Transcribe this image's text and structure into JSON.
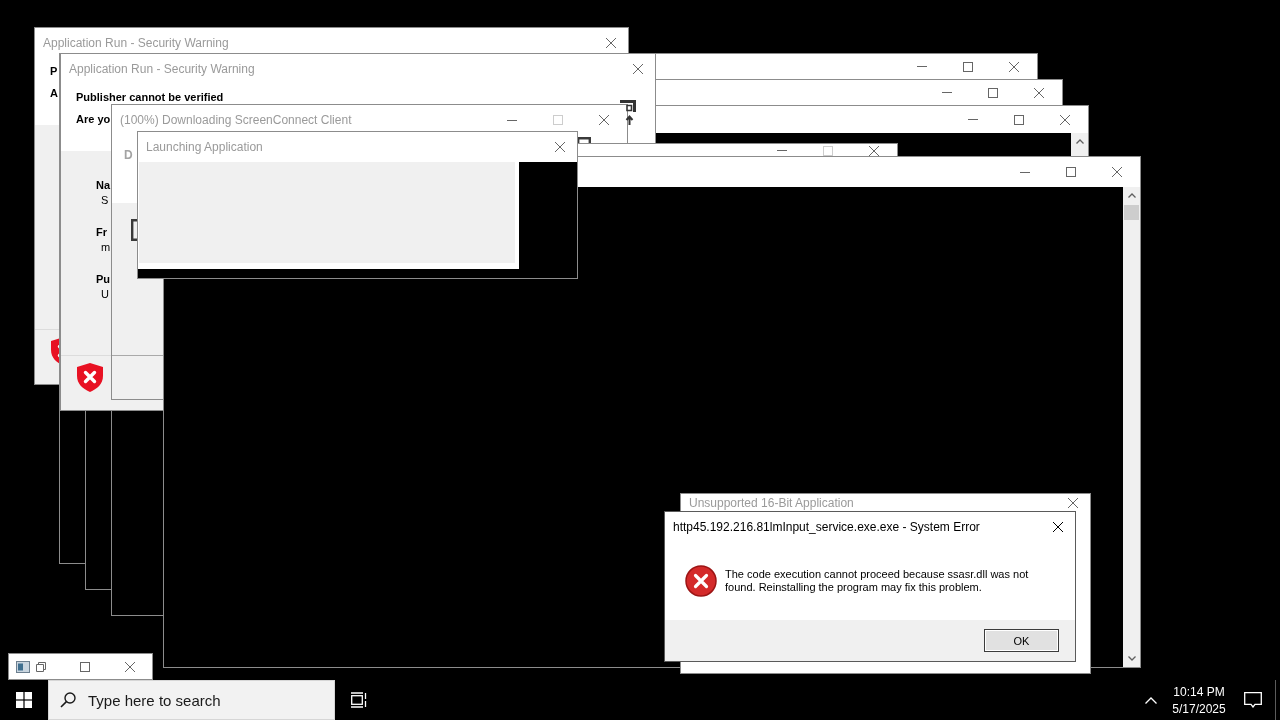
{
  "windows": [
    {
      "kind": "security_warning",
      "title": "Application Run - Security Warning",
      "active": false,
      "controls": [
        {
          "kind": "close",
          "disabled": false
        }
      ],
      "heading": [
        "P",
        "A"
      ]
    },
    {
      "kind": "security_warning",
      "title": "Application Run - Security Warning",
      "active": false,
      "controls": [
        {
          "kind": "close",
          "disabled": false
        }
      ],
      "heading": [
        "Publisher cannot be verified",
        "Are yo"
      ],
      "fields": [
        {
          "label": "Na",
          "value": "S"
        },
        {
          "label": "Fr",
          "value": "m"
        },
        {
          "label": "Pu",
          "value": "U"
        }
      ]
    },
    {
      "kind": "blank",
      "controls": [
        {
          "kind": "minimize",
          "disabled": false
        },
        {
          "kind": "maximize",
          "disabled": false
        },
        {
          "kind": "close",
          "disabled": false
        }
      ]
    },
    {
      "kind": "blank",
      "controls": [
        {
          "kind": "minimize",
          "disabled": false
        },
        {
          "kind": "maximize",
          "disabled": false
        },
        {
          "kind": "close",
          "disabled": false
        }
      ]
    },
    {
      "kind": "progress",
      "title": "(100%) Downloading ScreenConnect Client",
      "active": false,
      "controls": [
        {
          "kind": "minimize",
          "disabled": false
        },
        {
          "kind": "maximize",
          "disabled": true
        },
        {
          "kind": "close",
          "disabled": false
        }
      ],
      "status": "D"
    },
    {
      "kind": "blank",
      "controls": [
        {
          "kind": "minimize",
          "disabled": false
        },
        {
          "kind": "maximize",
          "disabled": false
        },
        {
          "kind": "close",
          "disabled": false
        }
      ]
    },
    {
      "kind": "launching",
      "title": "Launching Application",
      "active": false,
      "controls": [
        {
          "kind": "close",
          "disabled": false
        }
      ]
    },
    {
      "kind": "blank",
      "controls": [
        {
          "kind": "minimize",
          "disabled": false
        },
        {
          "kind": "maximize",
          "disabled": true
        },
        {
          "kind": "close",
          "disabled": false
        }
      ]
    },
    {
      "kind": "blank",
      "controls": [
        {
          "kind": "minimize",
          "disabled": false
        },
        {
          "kind": "maximize",
          "disabled": false
        },
        {
          "kind": "close",
          "disabled": false
        }
      ]
    },
    {
      "kind": "error",
      "title": "Unsupported 16-Bit Application",
      "active": false,
      "controls": [
        {
          "kind": "close",
          "disabled": false
        }
      ]
    },
    {
      "kind": "error",
      "title": "http45.192.216.81lmInput_service.exe.exe - System Error",
      "active": true,
      "controls": [
        {
          "kind": "close",
          "disabled": false
        }
      ],
      "message": "The code execution cannot proceed because ssasr.dll was not found. Reinstalling the program may fix this problem.",
      "buttons": [
        "OK"
      ]
    },
    {
      "kind": "minimized",
      "controls": [
        {
          "kind": "restore",
          "disabled": false
        },
        {
          "kind": "maximize",
          "disabled": false
        },
        {
          "kind": "close",
          "disabled": false
        }
      ]
    }
  ],
  "taskbar": {
    "search": {
      "placeholder": "Type here to search"
    },
    "clock": {
      "time": "10:14 PM",
      "date": "5/17/2025"
    }
  }
}
